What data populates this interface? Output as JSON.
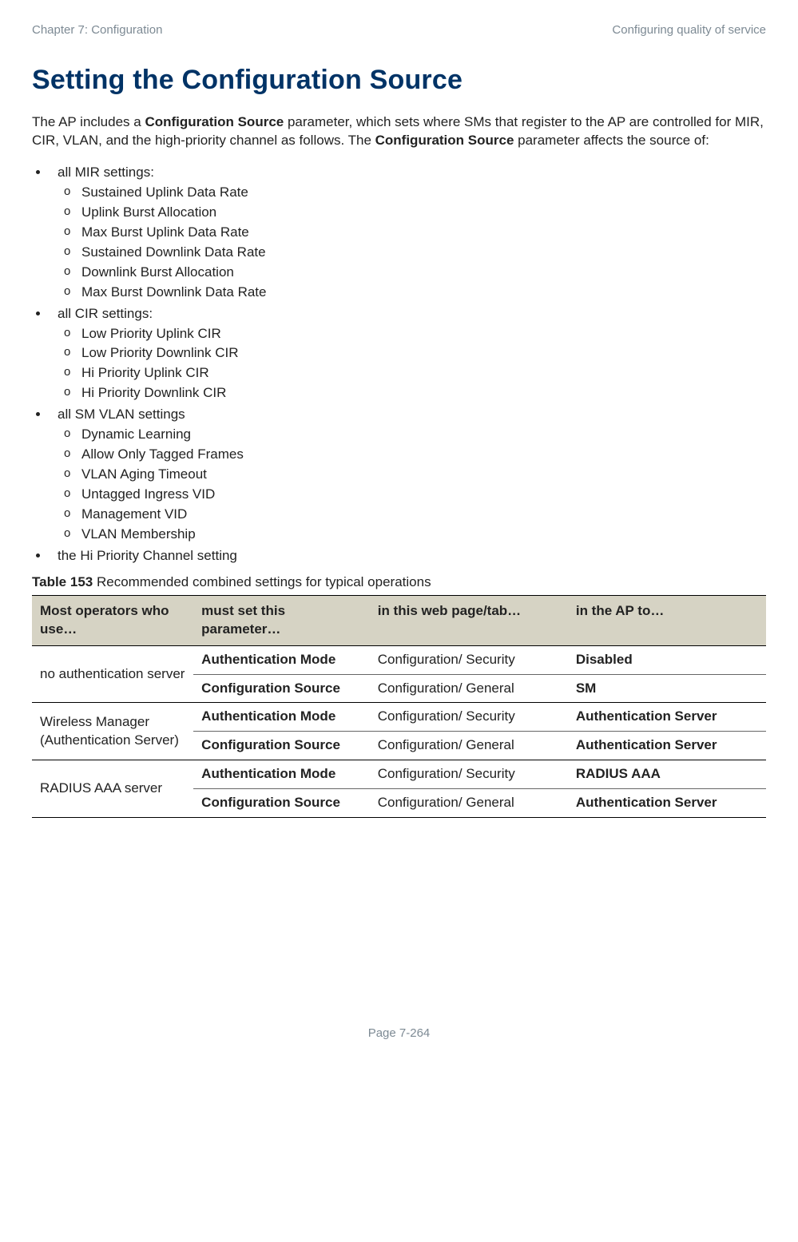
{
  "header": {
    "left": "Chapter 7:  Configuration",
    "right": "Configuring quality of service"
  },
  "title": "Setting the Configuration Source",
  "intro": {
    "p1a": "The AP includes a ",
    "p1b": "Configuration Source",
    "p1c": " parameter, which sets where SMs that register to the AP are controlled for MIR, CIR, VLAN, and the high-priority channel as follows. The ",
    "p1d": "Configuration Source",
    "p1e": " parameter affects the source of:"
  },
  "bullets": [
    {
      "text": "all MIR settings:",
      "sub": [
        "Sustained Uplink Data Rate",
        "Uplink Burst Allocation",
        "Max Burst Uplink Data Rate",
        "Sustained Downlink Data Rate",
        "Downlink Burst Allocation",
        "Max Burst Downlink Data Rate"
      ]
    },
    {
      "text": "all CIR settings:",
      "sub": [
        "Low Priority Uplink CIR",
        "Low Priority Downlink CIR",
        "Hi Priority Uplink CIR",
        "Hi Priority Downlink CIR"
      ]
    },
    {
      "text": "all SM VLAN settings",
      "sub": [
        "Dynamic Learning",
        "Allow Only Tagged Frames",
        "VLAN Aging Timeout",
        "Untagged Ingress VID",
        "Management VID",
        "VLAN Membership"
      ]
    },
    {
      "text": "the Hi Priority Channel setting",
      "sub": []
    }
  ],
  "table_caption": {
    "label": "Table 153",
    "text": " Recommended combined settings for typical operations"
  },
  "table": {
    "headers": [
      "Most operators who use…",
      "must set this parameter…",
      "in this web page/tab…",
      "in the AP to…"
    ],
    "rows": [
      {
        "span": "no authentication server",
        "param": "Authentication Mode",
        "page": "Configuration/ Security",
        "val": "Disabled",
        "bold_param": true,
        "bold_val": true
      },
      {
        "span": "",
        "param": "Configuration Source",
        "page": "Configuration/ General",
        "val": "SM",
        "bold_param": true,
        "bold_val": true
      },
      {
        "span": "Wireless Manager (Authentication Server)",
        "param": "Authentication Mode",
        "page": "Configuration/ Security",
        "val": "Authentication Server",
        "bold_param": true,
        "bold_val": true
      },
      {
        "span": "",
        "param": "Configuration Source",
        "page": "Configuration/ General",
        "val": "Authentication Server",
        "bold_param": true,
        "bold_val": true
      },
      {
        "span": "RADIUS AAA server",
        "param": "Authentication Mode",
        "page": "Configuration/ Security",
        "val": "RADIUS AAA",
        "bold_param": true,
        "bold_val": true
      },
      {
        "span": "",
        "param": "Configuration Source",
        "page": "Configuration/ General",
        "val": "Authentication Server",
        "bold_param": true,
        "bold_val": true
      }
    ]
  },
  "footer": "Page 7-264"
}
